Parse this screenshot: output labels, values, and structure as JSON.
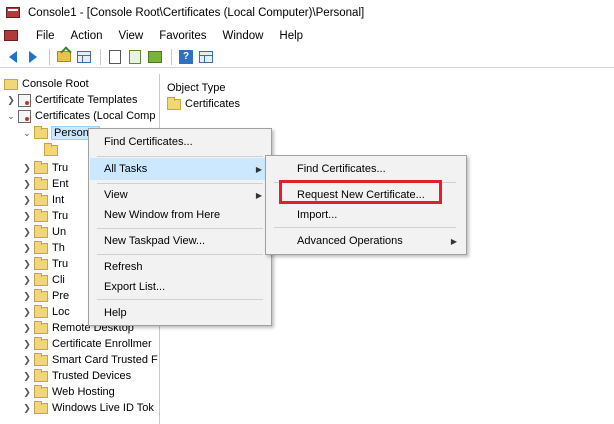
{
  "window": {
    "title": "Console1 - [Console Root\\Certificates (Local Computer)\\Personal]"
  },
  "menubar": {
    "items": [
      "File",
      "Action",
      "View",
      "Favorites",
      "Window",
      "Help"
    ]
  },
  "tree": {
    "console_root": "Console Root",
    "certificate_templates": "Certificate Templates",
    "certificates_local": "Certificates (Local Comp",
    "personal": "Personal",
    "children": [
      "Tru",
      "Ent",
      "Int",
      "Tru",
      "Un",
      "Th",
      "Tru",
      "Cli",
      "Pre",
      "Loc"
    ],
    "bottom": [
      "Remote Desktop",
      "Certificate Enrollmer",
      "Smart Card Trusted F",
      "Trusted Devices",
      "Web Hosting",
      "Windows Live ID Tok"
    ]
  },
  "main": {
    "column_header": "Object Type",
    "rows": [
      "Certificates"
    ]
  },
  "context_menu": {
    "find_certificates": "Find Certificates...",
    "all_tasks": "All Tasks",
    "view": "View",
    "new_window": "New Window from Here",
    "new_taskpad": "New Taskpad View...",
    "refresh": "Refresh",
    "export_list": "Export List...",
    "help": "Help"
  },
  "submenu": {
    "find_certificates": "Find Certificates...",
    "request_new_certificate": "Request New Certificate...",
    "import": "Import...",
    "advanced_operations": "Advanced Operations"
  },
  "colors": {
    "highlight_border": "#e0202a",
    "hover": "#cce8ff"
  }
}
